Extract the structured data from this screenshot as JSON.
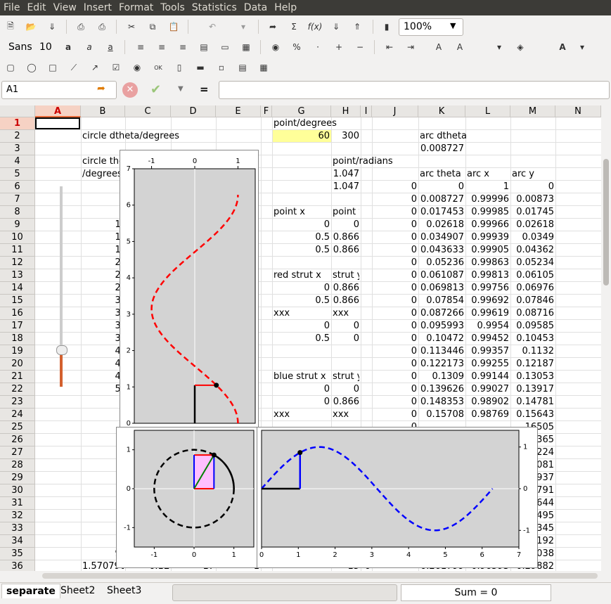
{
  "menu": [
    "File",
    "Edit",
    "View",
    "Insert",
    "Format",
    "Tools",
    "Statistics",
    "Data",
    "Help"
  ],
  "toolbar": {
    "zoom": "100%",
    "font_name": "Sans",
    "font_size": "10",
    "icons": [
      "new-icon",
      "open-icon",
      "save-icon",
      "print-icon",
      "print-preview-icon",
      "cut-icon",
      "copy-icon",
      "paste-icon",
      "undo-icon",
      "redo-icon",
      "goto-icon",
      "sum-icon",
      "function-icon",
      "sort-ascending-icon",
      "sort-descending-icon",
      "chart-icon"
    ]
  },
  "formula": {
    "cell_ref": "A1",
    "equals": "=",
    "value": ""
  },
  "columns": [
    "A",
    "B",
    "C",
    "D",
    "E",
    "F",
    "G",
    "H",
    "I",
    "J",
    "K",
    "L",
    "M",
    "N"
  ],
  "rows": [
    "1",
    "2",
    "3",
    "4",
    "5",
    "6",
    "7",
    "8",
    "9",
    "10",
    "11",
    "12",
    "13",
    "14",
    "15",
    "16",
    "17",
    "18",
    "19",
    "20",
    "21",
    "22",
    "23",
    "24",
    "25",
    "26",
    "27",
    "28",
    "29",
    "30",
    "31",
    "32",
    "33",
    "34",
    "35",
    "36"
  ],
  "cells": {
    "b2": "circle dtheta/degrees",
    "b4": "circle the",
    "b5": "/degrees",
    "g1": "point/degrees",
    "g2": "60",
    "h2": "300",
    "k2": "arc dtheta",
    "k3": "0.008727",
    "h4": "point/radians",
    "h5": "1.047",
    "h6": "1.047",
    "k5": "arc theta",
    "l5": "arc x",
    "m5": "arc y",
    "g8": "point x",
    "h8": "point y",
    "g9": "0",
    "h9": "0",
    "g10": "0.5",
    "h10": "0.866",
    "g11": "0.5",
    "h11": "0.866",
    "g13": "red strut x",
    "h13": "strut y",
    "g14": "0",
    "h14": "0.866",
    "g15": "0.5",
    "h15": "0.866",
    "g16": "xxx",
    "h16": "xxx",
    "g17": "0",
    "h17": "0",
    "g18": "0.5",
    "h18": "0",
    "g21": "blue strut x",
    "h21": "strut y",
    "g22": "0",
    "h22": "0",
    "g23": "0",
    "h23": "0.866",
    "g24": "xxx",
    "h24": "xxx",
    "j_col": [
      "0",
      "0",
      "0",
      "0",
      "0",
      "0",
      "0",
      "0",
      "0",
      "0",
      "0",
      "0",
      "0",
      "0",
      "0",
      "0",
      "0",
      "0",
      "0",
      "0"
    ],
    "k_col": [
      "0",
      "0.008727",
      "0.017453",
      "0.02618",
      "0.034907",
      "0.043633",
      "0.05236",
      "0.061087",
      "0.069813",
      "0.07854",
      "0.087266",
      "0.095993",
      "0.10472",
      "0.113446",
      "0.122173",
      "0.1309",
      "0.139626",
      "0.148353",
      "0.15708"
    ],
    "l_col": [
      "1",
      "0.99996",
      "0.99985",
      "0.99966",
      "0.99939",
      "0.99905",
      "0.99863",
      "0.99813",
      "0.99756",
      "0.99692",
      "0.99619",
      "0.9954",
      "0.99452",
      "0.99357",
      "0.99255",
      "0.99144",
      "0.99027",
      "0.98902",
      "0.98769"
    ],
    "m_col": [
      "0",
      "0.00873",
      "0.01745",
      "0.02618",
      "0.0349",
      "0.04362",
      "0.05234",
      "0.06105",
      "0.06976",
      "0.07846",
      "0.08716",
      "0.09585",
      "0.10453",
      "0.1132",
      "0.12187",
      "0.13053",
      "0.13917",
      "0.14781",
      "0.15643"
    ],
    "m_col_visible": [
      "16505",
      "365",
      "224",
      "081",
      "937",
      "791",
      "644",
      "495",
      "345",
      "192",
      "038",
      "0.29882"
    ],
    "b_col_partial": [
      "3",
      "9",
      "12",
      "15",
      "18",
      "21",
      "24",
      "27",
      "30",
      "33",
      "36",
      "39",
      "42",
      "45",
      "48",
      "51",
      "5",
      "6",
      "6",
      "6",
      "6",
      "7",
      "7",
      "7",
      "7",
      "8",
      "8",
      "8",
      "90"
    ],
    "row36_b": "1.570796",
    "row36_c": "6.1E",
    "row36_d": "17",
    "row36_e": "1",
    "row36_h": "15",
    "row36_i": "0",
    "row36_k": "0.261799",
    "row36_l": "0.96593"
  },
  "sheets": [
    "separate",
    "Sheet2",
    "Sheet3"
  ],
  "status": {
    "sum": "Sum = 0"
  },
  "colors": {
    "red": "#ff0000",
    "blue": "#0000ff",
    "black": "#000000",
    "green": "#008000",
    "magenta_fill": "#ffbfff",
    "plot_bg": "#d3d3d3",
    "highlight": "#ffff99"
  },
  "chart_data": [
    {
      "type": "line",
      "id": "cos-vertical",
      "xlim": [
        -1.4,
        1.4
      ],
      "ylim": [
        0,
        7
      ],
      "xticks": [
        "-1",
        "0",
        "1"
      ],
      "yticks": [
        "0",
        "1",
        "2",
        "3",
        "4",
        "5",
        "6",
        "7"
      ],
      "series": [
        {
          "style": "dashed",
          "color": "#ff0000",
          "fn": "x=cos(t)",
          "t_range": [
            0,
            6.283
          ]
        }
      ],
      "point": [
        0.5,
        1.047
      ]
    },
    {
      "type": "line",
      "id": "unit-circle",
      "xlim": [
        -1.5,
        1.5
      ],
      "ylim": [
        -1.5,
        1.5
      ],
      "xticks": [
        "-1",
        "0",
        "1"
      ],
      "yticks": [
        "-1",
        "0",
        "1"
      ],
      "point": [
        0.5,
        0.866
      ]
    },
    {
      "type": "line",
      "id": "sine-wave",
      "xlim": [
        0,
        7
      ],
      "ylim": [
        -1.4,
        1.4
      ],
      "xticks": [
        "0",
        "1",
        "2",
        "3",
        "4",
        "5",
        "6",
        "7"
      ],
      "yticks": [
        "-1",
        "0",
        "1"
      ],
      "series": [
        {
          "style": "dashed",
          "color": "#0000ff",
          "fn": "y=sin(x)",
          "x_range": [
            0,
            6.283
          ]
        }
      ],
      "point": [
        1.047,
        0.866
      ]
    }
  ]
}
